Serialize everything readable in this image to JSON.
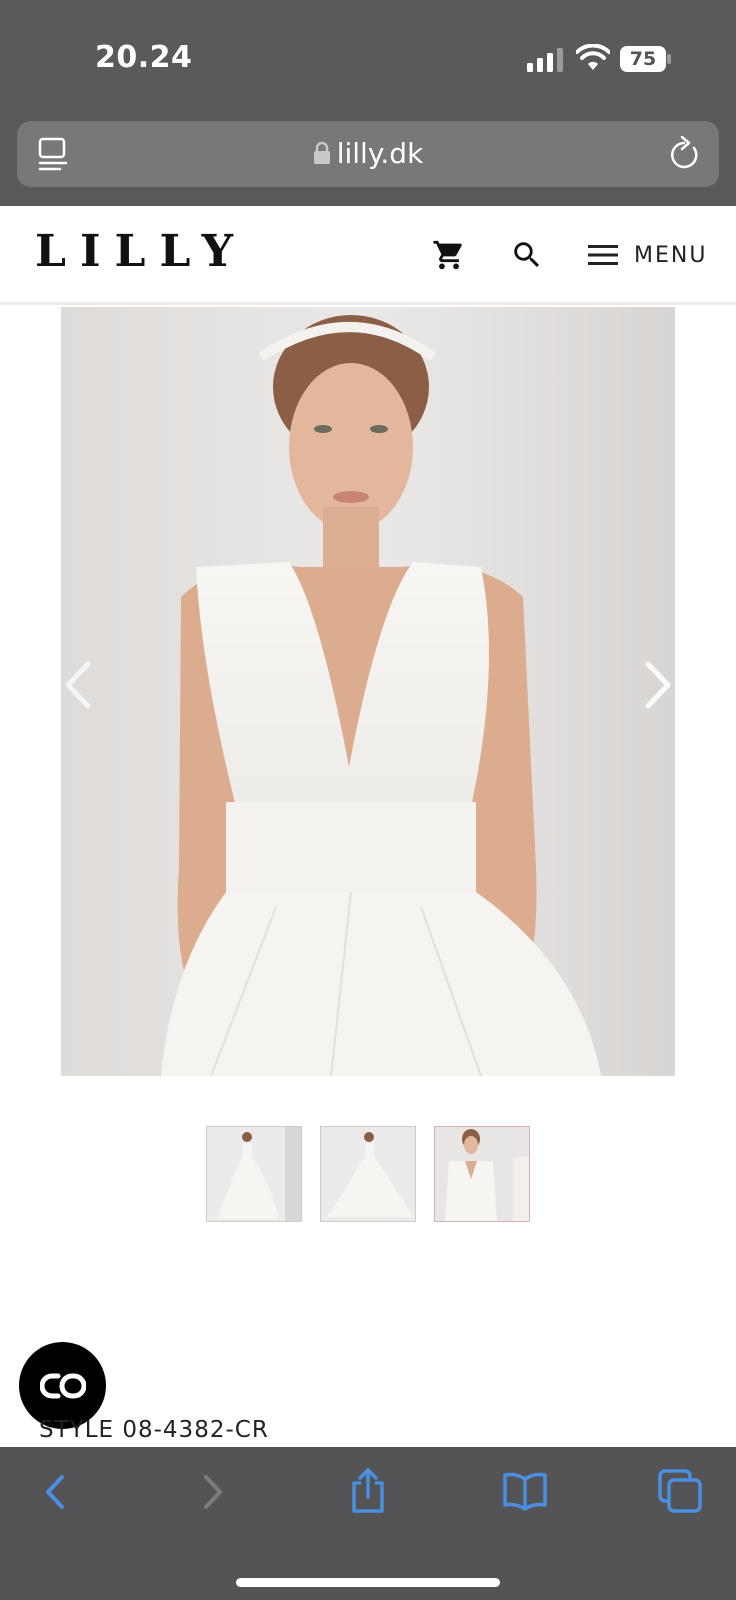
{
  "status_bar": {
    "time": "20.24",
    "battery": "75"
  },
  "browser": {
    "url": "lilly.dk"
  },
  "header": {
    "logo": "LILLY",
    "menu_label": "MENU"
  },
  "gallery": {
    "thumbnail_count": 3,
    "active_index": 2
  },
  "product": {
    "style_code": "STYLE 08-4382-CR"
  },
  "colors": {
    "accent": "#4a90e2",
    "status_bar_bg": "#5a5a5c",
    "toolbar_bg": "#545456"
  }
}
